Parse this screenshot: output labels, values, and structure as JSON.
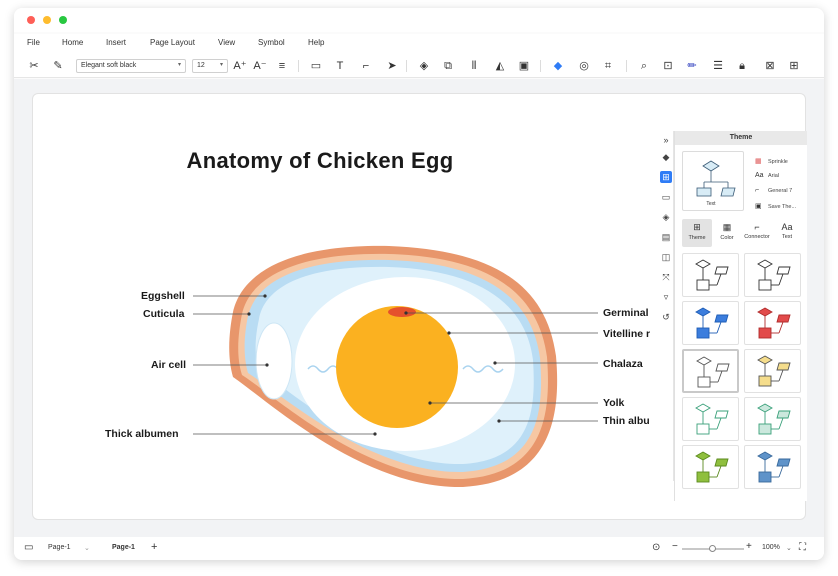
{
  "menu": [
    "File",
    "Home",
    "Insert",
    "Page Layout",
    "View",
    "Symbol",
    "Help"
  ],
  "toolbar": {
    "font": "Elegant soft black",
    "size": "12",
    "icons": [
      "cut-icon",
      "format-painter-icon",
      "font-grow-icon",
      "font-shrink-icon",
      "align-icon",
      "rectangle-icon",
      "text-icon",
      "connector-icon",
      "pointer-icon",
      "layers-icon",
      "group-icon",
      "align-left-icon",
      "flip-icon",
      "frame-icon",
      "fill-color-icon",
      "shape-style-icon",
      "crop-icon",
      "search-icon",
      "find-replace-icon",
      "line-color-icon",
      "line-style-icon",
      "lock-icon",
      "fit-icon",
      "more-icon"
    ]
  },
  "diagram": {
    "title": "Anatomy of Chicken Egg",
    "labels_left": [
      "Eggshell",
      "Cuticula",
      "Air cell",
      "Thick albumen"
    ],
    "labels_right": [
      "Germinal",
      "Vitelline r",
      "Chalaza",
      "Yolk",
      "Thin albu"
    ],
    "colors": {
      "shell": "#e8966b",
      "shell_inner": "#f6c7a3",
      "membrane": "#b9dcf3",
      "albumen_thin": "#dff1fb",
      "albumen_thick": "#ffffff",
      "yolk": "#fbb120",
      "germinal": "#e5512c"
    }
  },
  "panel": {
    "title": "Theme",
    "options": [
      "Sprinkle",
      "Arial",
      "General 7",
      "Save The..."
    ],
    "tabs": [
      "Theme",
      "Color",
      "Connector",
      "Text"
    ],
    "preview_node_label": "Text",
    "accent_colors": [
      "#ffffff",
      "#ffffff",
      "#3b7ddd",
      "#e24a4a",
      "#ffffff",
      "#f5dd8c",
      "#ffffff",
      "#cbe8dd",
      "#8fbf3e",
      "#5f93c9"
    ]
  },
  "status": {
    "page_selector": "Page-1",
    "active_page": "Page-1",
    "zoom": "100%"
  }
}
